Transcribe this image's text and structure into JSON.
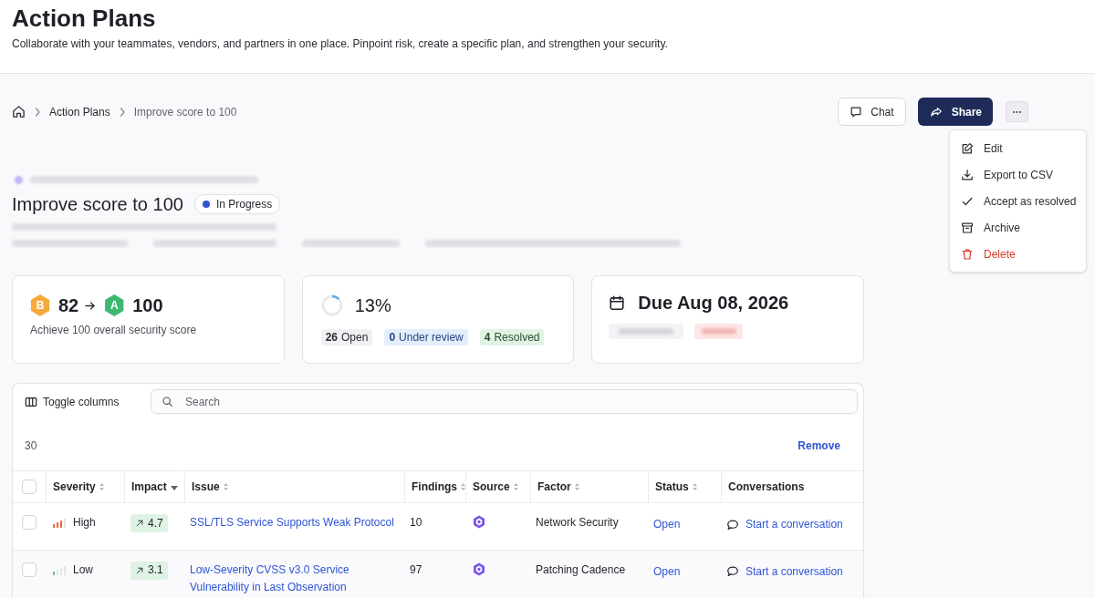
{
  "page_header": {
    "title": "Action Plans",
    "subtitle": "Collaborate with your teammates, vendors, and partners in one place. Pinpoint risk, create a specific plan, and strengthen your security."
  },
  "breadcrumb": [
    {
      "label": "Action Plans",
      "current": false
    },
    {
      "label": "Improve score to 100",
      "current": true
    }
  ],
  "actions": [
    {
      "label": "Chat",
      "kind": "secondary"
    },
    {
      "label": "Share",
      "kind": "primary"
    }
  ],
  "more_menu": {
    "open": true,
    "items": [
      {
        "label": "Edit",
        "danger": false
      },
      {
        "label": "Export to CSV",
        "danger": false
      },
      {
        "label": "Accept as resolved",
        "danger": false
      },
      {
        "label": "Archive",
        "danger": false
      },
      {
        "label": "Delete",
        "danger": true
      }
    ]
  },
  "plan": {
    "title": "Improve score to 100",
    "status": {
      "label": "In Progress",
      "color": "#2f54d6"
    }
  },
  "score_card": {
    "grades": [
      {
        "grade": "B",
        "score": "82",
        "color": "#f7a93b"
      },
      {
        "grade": "A",
        "score": "100",
        "color": "#3fb871"
      }
    ],
    "caption": "Achieve 100 overall security score"
  },
  "progress_card": {
    "level": 0.13,
    "percent": "13%",
    "counts": [
      {
        "count": "26",
        "label": "Open",
        "kind": "neutral"
      },
      {
        "count": "0",
        "label": "Under review",
        "kind": "info"
      },
      {
        "count": "4",
        "label": "Resolved",
        "kind": "success"
      }
    ]
  },
  "due_card": {
    "title": "Due Aug 08, 2026"
  },
  "table": {
    "toggle_label": "Toggle columns",
    "search_placeholder": "Search",
    "count": "30",
    "remove_label": "Remove",
    "select_all": {
      "checked": false
    },
    "columns": [
      {
        "label": "Severity",
        "sortable": true,
        "sorted": false
      },
      {
        "label": "Impact",
        "sortable": true,
        "sorted": true
      },
      {
        "label": "Issue",
        "sortable": true,
        "sorted": false
      },
      {
        "label": "Findings",
        "sortable": true,
        "sorted": false
      },
      {
        "label": "Source",
        "sortable": true,
        "sorted": false
      },
      {
        "label": "Factor",
        "sortable": true,
        "sorted": false
      },
      {
        "label": "Status",
        "sortable": true,
        "sorted": false
      },
      {
        "label": "Conversations",
        "sortable": false,
        "sorted": false
      }
    ],
    "rows": [
      {
        "checked": false,
        "severity": {
          "label": "High",
          "kind": "high",
          "color": "#f26b3a"
        },
        "impact": "4.7",
        "issue": "SSL/TLS Service Supports Weak Protocol",
        "findings": "10",
        "factor": "Network Security",
        "status": "Open",
        "conversation": "Start a conversation"
      },
      {
        "checked": false,
        "severity": {
          "label": "Low",
          "kind": "low",
          "color": "#6cc483"
        },
        "impact": "3.1",
        "issue": "Low-Severity CVSS v3.0 Service Vulnerability in Last Observation",
        "findings": "97",
        "factor": "Patching Cadence",
        "status": "Open",
        "conversation": "Start a conversation"
      }
    ]
  }
}
